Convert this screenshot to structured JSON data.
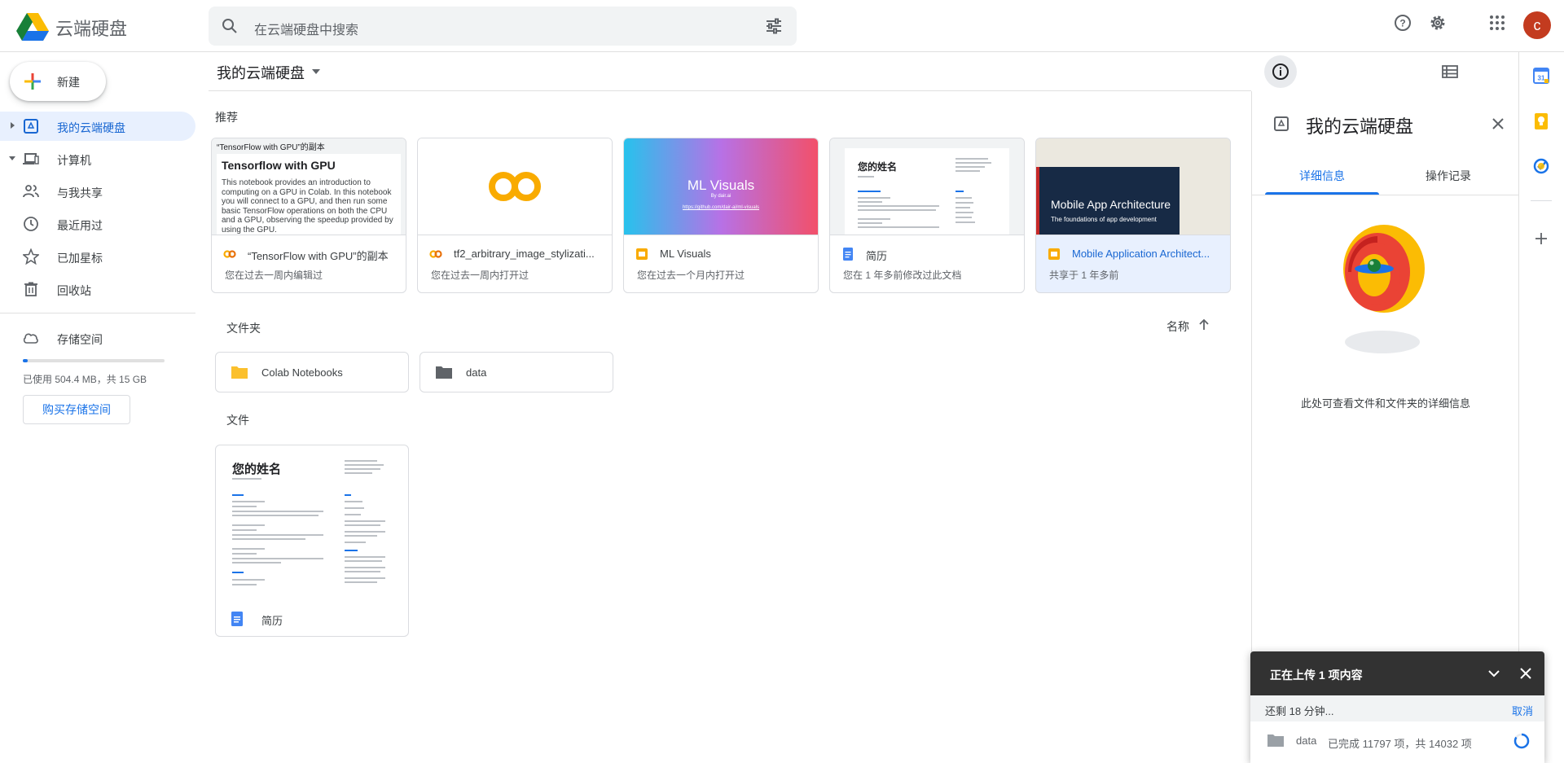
{
  "app": {
    "name": "云端硬盘",
    "avatar_initial": "c",
    "avatar_color": "#c33b1f",
    "accent": "#1a73e8"
  },
  "search": {
    "placeholder": "在云端硬盘中搜索"
  },
  "sidebar": {
    "new_label": "新建",
    "items": [
      {
        "label": "我的云端硬盘",
        "icon": "my-drive-icon",
        "active": true
      },
      {
        "label": "计算机",
        "icon": "computer-icon"
      },
      {
        "label": "与我共享",
        "icon": "shared-people-icon"
      },
      {
        "label": "最近用过",
        "icon": "clock-icon"
      },
      {
        "label": "已加星标",
        "icon": "star-icon"
      },
      {
        "label": "回收站",
        "icon": "trash-icon"
      }
    ],
    "storage": {
      "label": "存储空间",
      "used_text": "已使用 504.4 MB，共 15 GB",
      "used_fraction": 0.033,
      "buy_label": "购买存储空间"
    }
  },
  "main": {
    "breadcrumb": "我的云端硬盘",
    "recommended_title": "推荐",
    "recommended": [
      {
        "name": "“TensorFlow with GPU”的副本",
        "sub": "您在过去一周内编辑过",
        "icon": "colab-icon",
        "thumb": {
          "top": "“TensorFlow with GPU”的副本",
          "heading": "Tensorflow with GPU",
          "body": "This notebook provides an introduction to computing on a GPU in Colab. In this notebook you will connect to a GPU, and then run some basic TensorFlow operations on both the CPU and a GPU, observing the speedup provided by using the GPU."
        }
      },
      {
        "name": "tf2_arbitrary_image_stylizati...",
        "sub": "您在过去一周内打开过",
        "icon": "colab-icon"
      },
      {
        "name": "ML Visuals",
        "sub": "您在过去一个月内打开过",
        "icon": "slides-icon",
        "thumb": {
          "title": "ML Visuals",
          "by": "By dair.ai",
          "link": "https://github.com/dair-ai/ml-visuals"
        }
      },
      {
        "name": "简历",
        "sub": "您在 1 年多前修改过此文档",
        "icon": "docs-icon",
        "thumb": {
          "heading": "您的姓名"
        }
      },
      {
        "name": "Mobile Application Architect...",
        "sub": "共享于 1 年多前",
        "icon": "slides-icon",
        "selected": true,
        "thumb": {
          "title": "Mobile App Architecture",
          "subtitle": "The foundations of app development"
        }
      }
    ],
    "folders_title": "文件夹",
    "sort_label": "名称",
    "folders": [
      {
        "name": "Colab Notebooks",
        "color": "#fbc02d"
      },
      {
        "name": "data",
        "color": "#5f6368"
      }
    ],
    "files_title": "文件",
    "files": [
      {
        "name": "简历",
        "thumb_heading": "您的姓名"
      }
    ]
  },
  "details": {
    "title": "我的云端硬盘",
    "tabs": [
      "详细信息",
      "操作记录"
    ],
    "hint": "此处可查看文件和文件夹的详细信息"
  },
  "upload": {
    "title": "正在上传 1 项内容",
    "remaining": "还剩 18 分钟...",
    "cancel": "取消",
    "item_name": "data",
    "progress_text": "已完成 11797 项，共 14032 项",
    "completed": 11797,
    "total": 14032
  }
}
